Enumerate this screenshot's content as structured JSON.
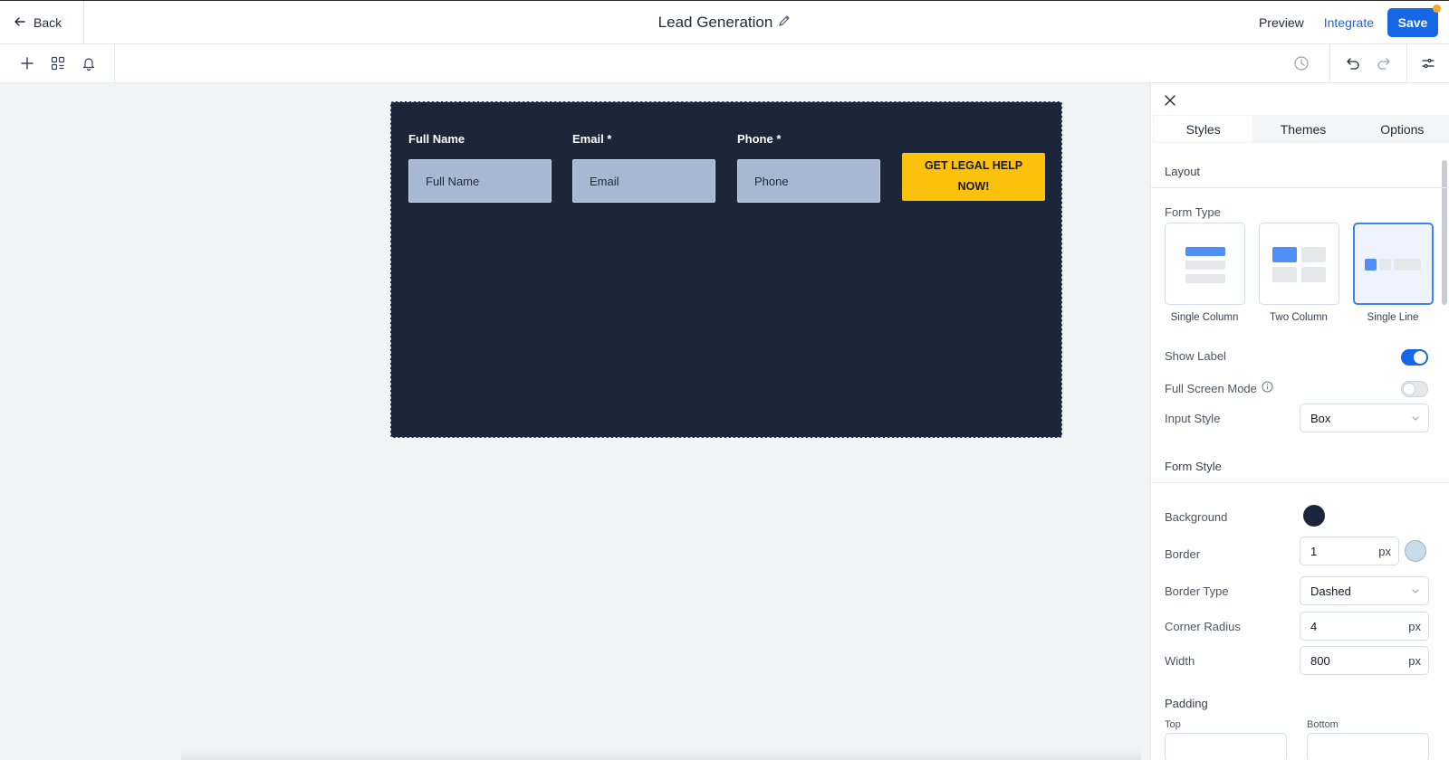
{
  "header": {
    "back_label": "Back",
    "title": "Lead Generation",
    "preview_label": "Preview",
    "integrate_label": "Integrate",
    "save_label": "Save"
  },
  "toolbar": {
    "left_icons": [
      "plus-icon",
      "layers-icon",
      "bell-icon"
    ],
    "right_icons": [
      "history-icon",
      "undo-icon",
      "redo-icon",
      "settings-sliders-icon"
    ]
  },
  "form": {
    "fields": [
      {
        "label": "Full Name",
        "placeholder": "Full Name"
      },
      {
        "label": "Email *",
        "placeholder": "Email"
      },
      {
        "label": "Phone *",
        "placeholder": "Phone"
      }
    ],
    "cta_line1": "GET LEGAL HELP",
    "cta_line2": "NOW!",
    "background_color": "#1b263b",
    "input_color": "#a8b8d3",
    "cta_color": "#fcc10a"
  },
  "panel": {
    "tabs": [
      {
        "label": "Styles",
        "active": true
      },
      {
        "label": "Themes",
        "active": false
      },
      {
        "label": "Options",
        "active": false
      }
    ],
    "layout_heading": "Layout",
    "form_type_label": "Form Type",
    "form_types": [
      {
        "label": "Single Column",
        "selected": false
      },
      {
        "label": "Two Column",
        "selected": false
      },
      {
        "label": "Single Line",
        "selected": true
      }
    ],
    "show_label": {
      "label": "Show Label",
      "on": true
    },
    "full_screen": {
      "label": "Full Screen Mode",
      "on": false
    },
    "input_style": {
      "label": "Input Style",
      "value": "Box"
    },
    "form_style_heading": "Form Style",
    "background": {
      "label": "Background",
      "color": "#1b263b"
    },
    "border": {
      "label": "Border",
      "value": "1",
      "unit": "px",
      "color": "#c9dae9"
    },
    "border_type": {
      "label": "Border Type",
      "value": "Dashed"
    },
    "corner_radius": {
      "label": "Corner Radius",
      "value": "4",
      "unit": "px"
    },
    "width": {
      "label": "Width",
      "value": "800",
      "unit": "px"
    },
    "padding_heading": "Padding",
    "padding_top_label": "Top",
    "padding_bottom_label": "Bottom"
  }
}
